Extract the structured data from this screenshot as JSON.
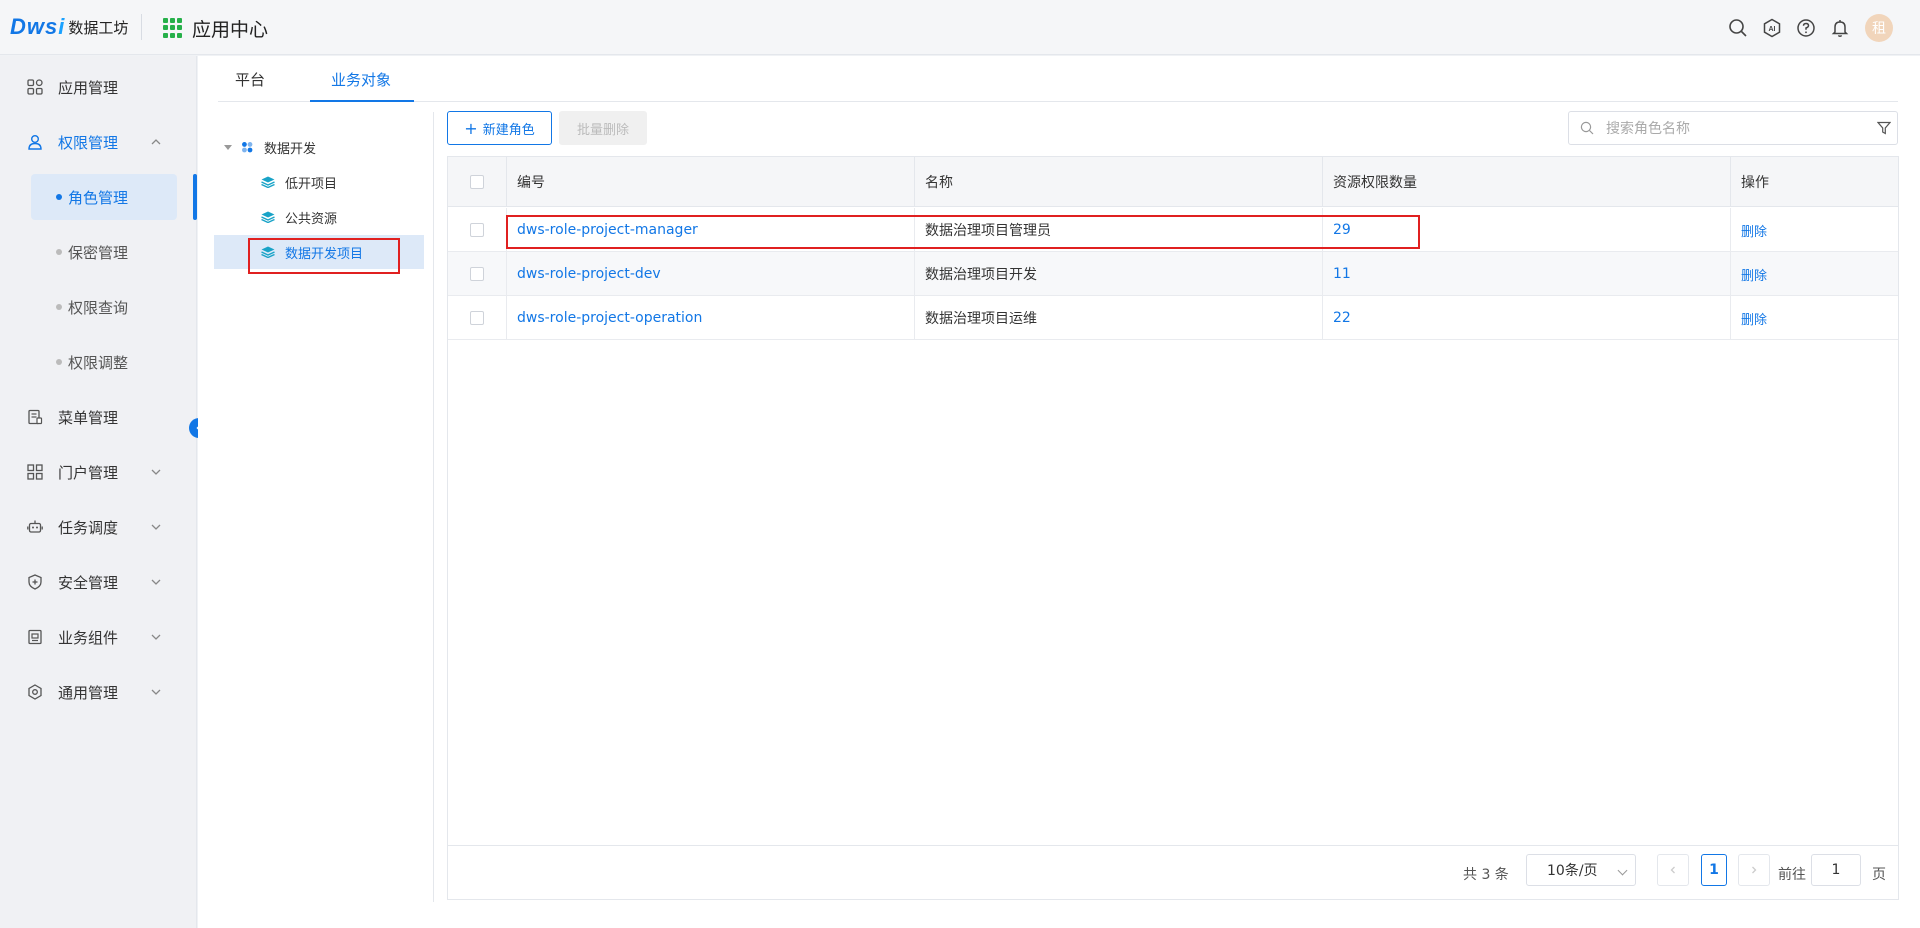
{
  "header": {
    "logo_mark": "Dws",
    "logo_mark_i": "i",
    "logo_text": "数据工坊",
    "app_center_label": "应用中心",
    "avatar_text": "租"
  },
  "sidebar": {
    "items": [
      {
        "label": "应用管理",
        "icon": "app-grid-icon"
      },
      {
        "label": "权限管理",
        "icon": "user-icon"
      },
      {
        "label": "菜单管理",
        "icon": "menu-doc-icon"
      },
      {
        "label": "门户管理",
        "icon": "portal-icon"
      },
      {
        "label": "任务调度",
        "icon": "robot-icon"
      },
      {
        "label": "安全管理",
        "icon": "shield-icon"
      },
      {
        "label": "业务组件",
        "icon": "component-icon"
      },
      {
        "label": "通用管理",
        "icon": "settings-icon"
      }
    ],
    "sub_items": [
      {
        "label": "角色管理",
        "active": true
      },
      {
        "label": "保密管理",
        "active": false
      },
      {
        "label": "权限查询",
        "active": false
      },
      {
        "label": "权限调整",
        "active": false
      }
    ]
  },
  "tabs": [
    {
      "label": "平台",
      "active": false
    },
    {
      "label": "业务对象",
      "active": true
    }
  ],
  "tree": {
    "root": "数据开发",
    "children": [
      {
        "label": "低开项目",
        "selected": false
      },
      {
        "label": "公共资源",
        "selected": false
      },
      {
        "label": "数据开发项目",
        "selected": true
      }
    ]
  },
  "toolbar": {
    "new_role_label": "新建角色",
    "batch_delete_label": "批量删除",
    "search_placeholder": "搜索角色名称"
  },
  "table": {
    "columns": [
      "编号",
      "名称",
      "资源权限数量",
      "操作"
    ],
    "rows": [
      {
        "code": "dws-role-project-manager",
        "name": "数据治理项目管理员",
        "count": "29",
        "action": "删除"
      },
      {
        "code": "dws-role-project-dev",
        "name": "数据治理项目开发",
        "count": "11",
        "action": "删除"
      },
      {
        "code": "dws-role-project-operation",
        "name": "数据治理项目运维",
        "count": "22",
        "action": "删除"
      }
    ]
  },
  "pagination": {
    "total_text": "共 3 条",
    "page_size": "10条/页",
    "current_page": "1",
    "goto_prefix": "前往",
    "goto_value": "1",
    "goto_suffix": "页"
  },
  "colors": {
    "accent": "#1277e6",
    "highlight_box": "#e02020",
    "selected_bg": "#dde9f8"
  }
}
